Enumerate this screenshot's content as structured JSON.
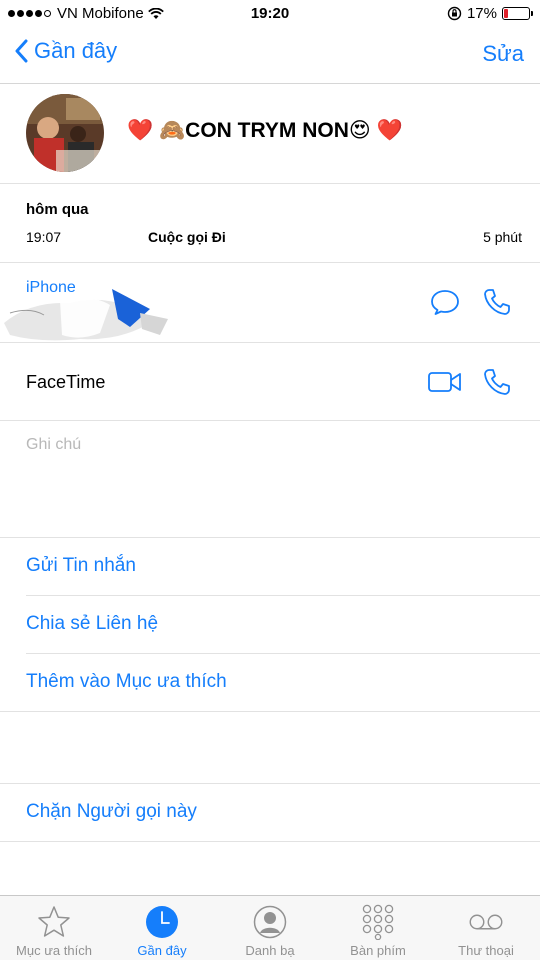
{
  "status": {
    "carrier": "VN Mobifone",
    "time": "19:20",
    "battery": "17%",
    "battery_level": 0.17
  },
  "nav": {
    "back_label": "Gần đây",
    "edit_label": "Sửa"
  },
  "contact": {
    "name_heart_left": "❤️",
    "name_monkey": "🙈",
    "name_text": "CON TRYM NON",
    "name_smiley": "😍",
    "name_heart_right": "❤️"
  },
  "recent": {
    "date": "hôm qua",
    "time": "19:07",
    "type": "Cuộc gọi Đi",
    "duration": "5 phút"
  },
  "phone": {
    "label": "iPhone"
  },
  "facetime": {
    "label": "FaceTime"
  },
  "notes": {
    "placeholder": "Ghi chú"
  },
  "actions": {
    "send_message": "Gửi Tin nhắn",
    "share_contact": "Chia sẻ Liên hệ",
    "add_favorite": "Thêm vào Mục ưa thích",
    "block_caller": "Chặn Người gọi này"
  },
  "tabs": [
    {
      "label": "Mục ưa thích",
      "icon": "star-icon"
    },
    {
      "label": "Gần đây",
      "icon": "clock-icon"
    },
    {
      "label": "Danh bạ",
      "icon": "contacts-icon"
    },
    {
      "label": "Bàn phím",
      "icon": "keypad-icon"
    },
    {
      "label": "Thư thoại",
      "icon": "voicemail-icon"
    }
  ],
  "colors": {
    "accent": "#157efb",
    "battery_low": "#e0202a",
    "inactive": "#929292"
  }
}
